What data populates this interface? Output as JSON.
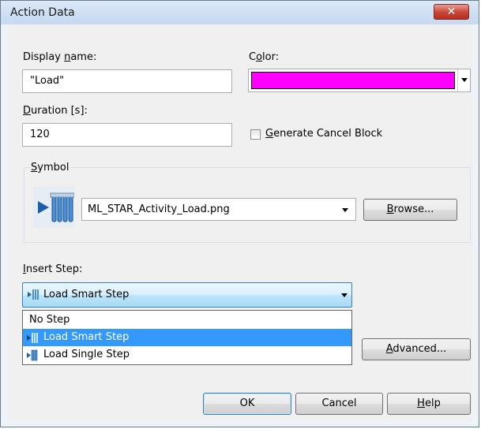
{
  "window": {
    "title": "Action Data",
    "close_glyph": "✕"
  },
  "display_name": {
    "label_pre": "Display ",
    "label_u": "n",
    "label_post": "ame:",
    "value": "\"Load\""
  },
  "color": {
    "label_pre": "C",
    "label_u": "o",
    "label_post": "lor:",
    "swatch": "#ff00ff"
  },
  "duration": {
    "label_pre": "",
    "label_u": "D",
    "label_post": "uration [s]:",
    "value": "120"
  },
  "cancel_block": {
    "label_pre": "",
    "label_u": "G",
    "label_post": "enerate Cancel Block",
    "checked": false
  },
  "symbol": {
    "group_label_pre": "",
    "group_label_u": "S",
    "group_label_post": "ymbol",
    "icon": "load-activity-icon",
    "value": "ML_STAR_Activity_Load.png",
    "browse_pre": "",
    "browse_u": "B",
    "browse_post": "rowse..."
  },
  "insert_step": {
    "label_pre": "",
    "label_u": "I",
    "label_post": "nsert Step:",
    "selected": "Load Smart Step",
    "options": [
      {
        "label": "No Step",
        "icon": ""
      },
      {
        "label": "Load Smart Step",
        "icon": "smart-step-icon",
        "highlighted": true
      },
      {
        "label": "Load Single Step",
        "icon": "single-step-icon"
      }
    ]
  },
  "advanced": {
    "pre": "",
    "u": "A",
    "post": "dvanced..."
  },
  "buttons": {
    "ok": "OK",
    "cancel": "Cancel",
    "help_pre": "",
    "help_u": "H",
    "help_post": "elp"
  },
  "colors": {
    "highlight": "#3399ff",
    "accent_color": "#ff00ff"
  }
}
